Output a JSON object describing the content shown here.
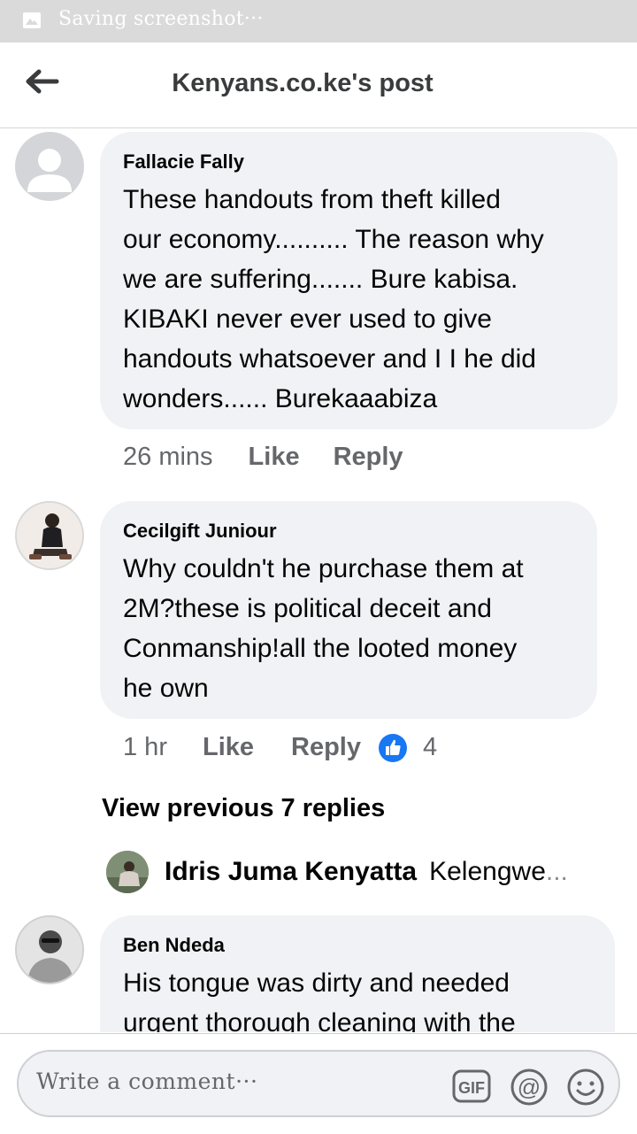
{
  "status_bar": {
    "text": "Saving screenshot···"
  },
  "header": {
    "title": "Kenyans.co.ke's post"
  },
  "comments": [
    {
      "author": "Fallacie Fally",
      "lines": [
        "These handouts from theft killed",
        "our economy.......... The reason why",
        "we are suffering....... Bure kabisa.",
        "KIBAKI never ever used to give",
        "handouts whatsoever and I I he did",
        "wonders...... Burekaaabiza"
      ],
      "time": "26 mins",
      "like": "Like",
      "reply": "Reply"
    },
    {
      "author": "Cecilgift Juniour",
      "lines": [
        "Why couldn't he purchase them at",
        "2M?these is political deceit and",
        "Conmanship!all the looted money",
        "he own"
      ],
      "time": "1 hr",
      "like": "Like",
      "reply": "Reply",
      "reaction_count": "4"
    },
    {
      "author": "Ben Ndeda",
      "lines": [
        "His tongue was dirty and needed",
        "urgent thorough cleaning with the"
      ]
    }
  ],
  "view_previous": "View previous 7 replies",
  "latest_reply": {
    "author": "Idris Juma Kenyatta",
    "text": "Kelengwe",
    "ellipsis": "..."
  },
  "composer": {
    "placeholder": "Write a comment···",
    "gif_label": "GIF"
  },
  "colors": {
    "like_blue": "#1877f2",
    "bubble": "#f0f2f5",
    "meta": "#65676b"
  }
}
